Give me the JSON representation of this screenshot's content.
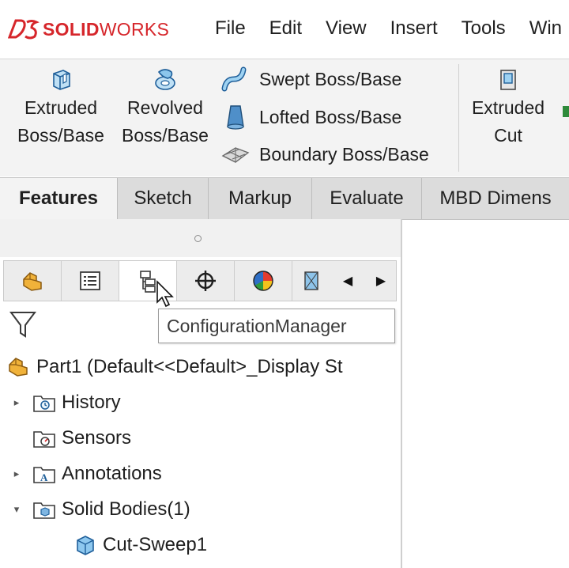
{
  "app": {
    "logo_prefix": "SOLID",
    "logo_suffix": "WORKS",
    "brand_color": "#d6262b"
  },
  "menu": [
    "File",
    "Edit",
    "View",
    "Insert",
    "Tools",
    "Win"
  ],
  "ribbon": {
    "extruded_boss": [
      "Extruded",
      "Boss/Base"
    ],
    "revolved_boss": [
      "Revolved",
      "Boss/Base"
    ],
    "swept_boss": "Swept Boss/Base",
    "lofted_boss": "Lofted Boss/Base",
    "boundary_boss": "Boundary Boss/Base",
    "extruded_cut": [
      "Extruded",
      "Cut"
    ]
  },
  "tabs": [
    "Features",
    "Sketch",
    "Markup",
    "Evaluate",
    "MBD Dimens"
  ],
  "tooltip": "ConfigurationManager",
  "tree": {
    "root": "Part1  (Default<<Default>_Display St",
    "items": [
      "History",
      "Sensors",
      "Annotations",
      "Solid Bodies(1)",
      "Cut-Sweep1"
    ]
  }
}
